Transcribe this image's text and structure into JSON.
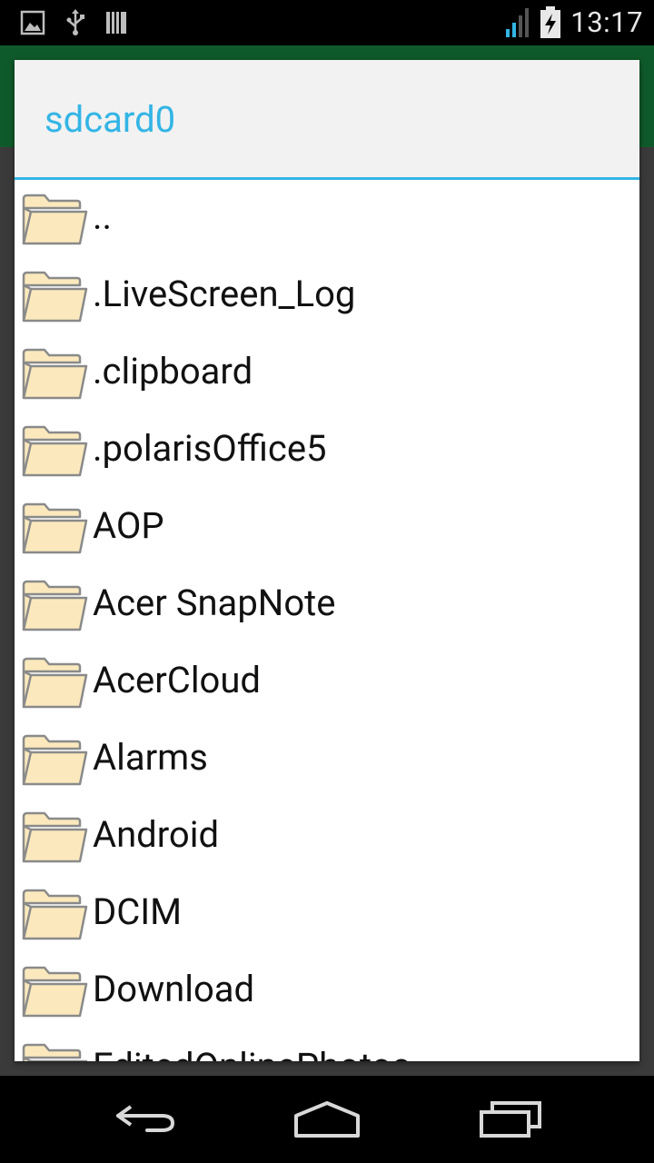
{
  "status_bar": {
    "time": "13:17",
    "icons_left": [
      "image-icon",
      "usb-icon",
      "sd-card-icon"
    ],
    "icons_right": [
      "signal-icon",
      "battery-charging-icon"
    ]
  },
  "dialog": {
    "title": "sdcard0",
    "accent_color": "#33b5e5",
    "items": [
      {
        "name": ".."
      },
      {
        "name": ".LiveScreen_Log"
      },
      {
        "name": ".clipboard"
      },
      {
        "name": ".polarisOffice5"
      },
      {
        "name": "AOP"
      },
      {
        "name": "Acer SnapNote"
      },
      {
        "name": "AcerCloud"
      },
      {
        "name": "Alarms"
      },
      {
        "name": "Android"
      },
      {
        "name": "DCIM"
      },
      {
        "name": "Download"
      },
      {
        "name": "EditedOnlinePhotos"
      }
    ]
  },
  "nav_bar": {
    "buttons": [
      "back-icon",
      "home-icon",
      "recent-apps-icon"
    ]
  }
}
